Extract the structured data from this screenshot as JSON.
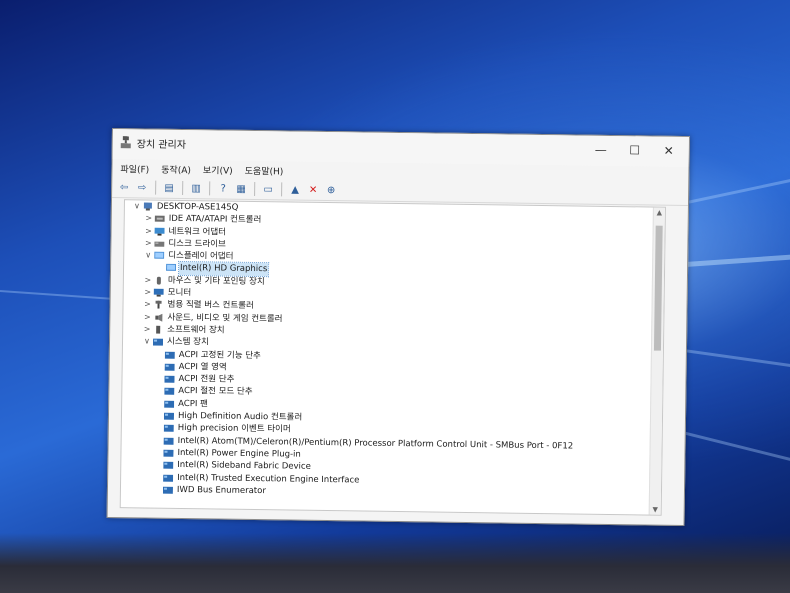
{
  "window": {
    "title": "장치 관리자",
    "controls": {
      "minimize": "—",
      "maximize": "☐",
      "close": "✕"
    }
  },
  "menu": [
    {
      "label": "파일(F)"
    },
    {
      "label": "동작(A)"
    },
    {
      "label": "보기(V)"
    },
    {
      "label": "도움말(H)"
    }
  ],
  "toolbar": [
    {
      "icon": "back-arrow-icon",
      "glyph": "⇦"
    },
    {
      "icon": "forward-arrow-icon",
      "glyph": "⇨"
    },
    {
      "sep": true
    },
    {
      "icon": "device-list-icon",
      "glyph": "▤"
    },
    {
      "sep": true
    },
    {
      "icon": "properties-icon",
      "glyph": "▥"
    },
    {
      "sep": true
    },
    {
      "icon": "help-icon",
      "glyph": "?"
    },
    {
      "icon": "device-resources-icon",
      "glyph": "▦"
    },
    {
      "sep": true
    },
    {
      "icon": "monitor-scan-icon",
      "glyph": "▭"
    },
    {
      "sep": true
    },
    {
      "icon": "add-driver-icon",
      "glyph": "▲"
    },
    {
      "icon": "uninstall-icon",
      "glyph": "✕",
      "color": "#d41a1a"
    },
    {
      "icon": "update-driver-icon",
      "glyph": "⊕"
    }
  ],
  "tree": [
    {
      "label": "DESKTOP-ASE145Q",
      "level": 0,
      "exp": "∨",
      "icon": "computer-icon"
    },
    {
      "label": "IDE ATA/ATAPI 컨트롤러",
      "level": 1,
      "exp": ">",
      "icon": "ide-controller-icon"
    },
    {
      "label": "네트워크 어댑터",
      "level": 1,
      "exp": ">",
      "icon": "network-adapter-icon"
    },
    {
      "label": "디스크 드라이브",
      "level": 1,
      "exp": ">",
      "icon": "disk-drive-icon"
    },
    {
      "label": "디스플레이 어댑터",
      "level": 1,
      "exp": "∨",
      "icon": "display-adapter-icon"
    },
    {
      "label": "Intel(R) HD Graphics",
      "level": 2,
      "exp": "",
      "icon": "display-adapter-icon",
      "selected": true
    },
    {
      "label": "마우스 및 기타 포인팅 장치",
      "level": 1,
      "exp": ">",
      "icon": "mouse-icon"
    },
    {
      "label": "모니터",
      "level": 1,
      "exp": ">",
      "icon": "monitor-icon"
    },
    {
      "label": "범용 직렬 버스 컨트롤러",
      "level": 1,
      "exp": ">",
      "icon": "usb-controller-icon"
    },
    {
      "label": "사운드, 비디오 및 게임 컨트롤러",
      "level": 1,
      "exp": ">",
      "icon": "sound-icon"
    },
    {
      "label": "소프트웨어 장치",
      "level": 1,
      "exp": ">",
      "icon": "software-device-icon"
    },
    {
      "label": "시스템 장치",
      "level": 1,
      "exp": "∨",
      "icon": "system-device-icon"
    },
    {
      "label": "ACPI 고정된 기능 단추",
      "level": 2,
      "exp": "",
      "icon": "system-device-icon"
    },
    {
      "label": "ACPI 열 영역",
      "level": 2,
      "exp": "",
      "icon": "system-device-icon"
    },
    {
      "label": "ACPI 전원 단추",
      "level": 2,
      "exp": "",
      "icon": "system-device-icon"
    },
    {
      "label": "ACPI 절전 모드 단추",
      "level": 2,
      "exp": "",
      "icon": "system-device-icon"
    },
    {
      "label": "ACPI 팬",
      "level": 2,
      "exp": "",
      "icon": "system-device-icon"
    },
    {
      "label": "High Definition Audio 컨트롤러",
      "level": 2,
      "exp": "",
      "icon": "system-device-icon"
    },
    {
      "label": "High precision 이벤트 타이머",
      "level": 2,
      "exp": "",
      "icon": "system-device-icon"
    },
    {
      "label": "Intel(R) Atom(TM)/Celeron(R)/Pentium(R) Processor Platform Control Unit - SMBus Port - 0F12",
      "level": 2,
      "exp": "",
      "icon": "system-device-icon"
    },
    {
      "label": "Intel(R) Power Engine Plug-in",
      "level": 2,
      "exp": "",
      "icon": "system-device-icon"
    },
    {
      "label": "Intel(R) Sideband Fabric Device",
      "level": 2,
      "exp": "",
      "icon": "system-device-icon"
    },
    {
      "label": "Intel(R) Trusted Execution Engine Interface",
      "level": 2,
      "exp": "",
      "icon": "system-device-icon"
    },
    {
      "label": "IWD Bus Enumerator",
      "level": 2,
      "exp": "",
      "icon": "system-device-icon"
    }
  ]
}
